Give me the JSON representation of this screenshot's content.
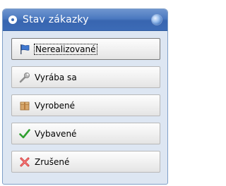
{
  "window": {
    "title": "Stav zákazky"
  },
  "items": [
    {
      "label": "Nerealizované",
      "icon": "blue-flag-icon",
      "active": true
    },
    {
      "label": "Vyrába sa",
      "icon": "wrench-icon",
      "active": false
    },
    {
      "label": "Vyrobené",
      "icon": "package-icon",
      "active": false
    },
    {
      "label": "Vybavené",
      "icon": "green-check-icon",
      "active": false
    },
    {
      "label": "Zrušené",
      "icon": "red-x-icon",
      "active": false
    }
  ]
}
